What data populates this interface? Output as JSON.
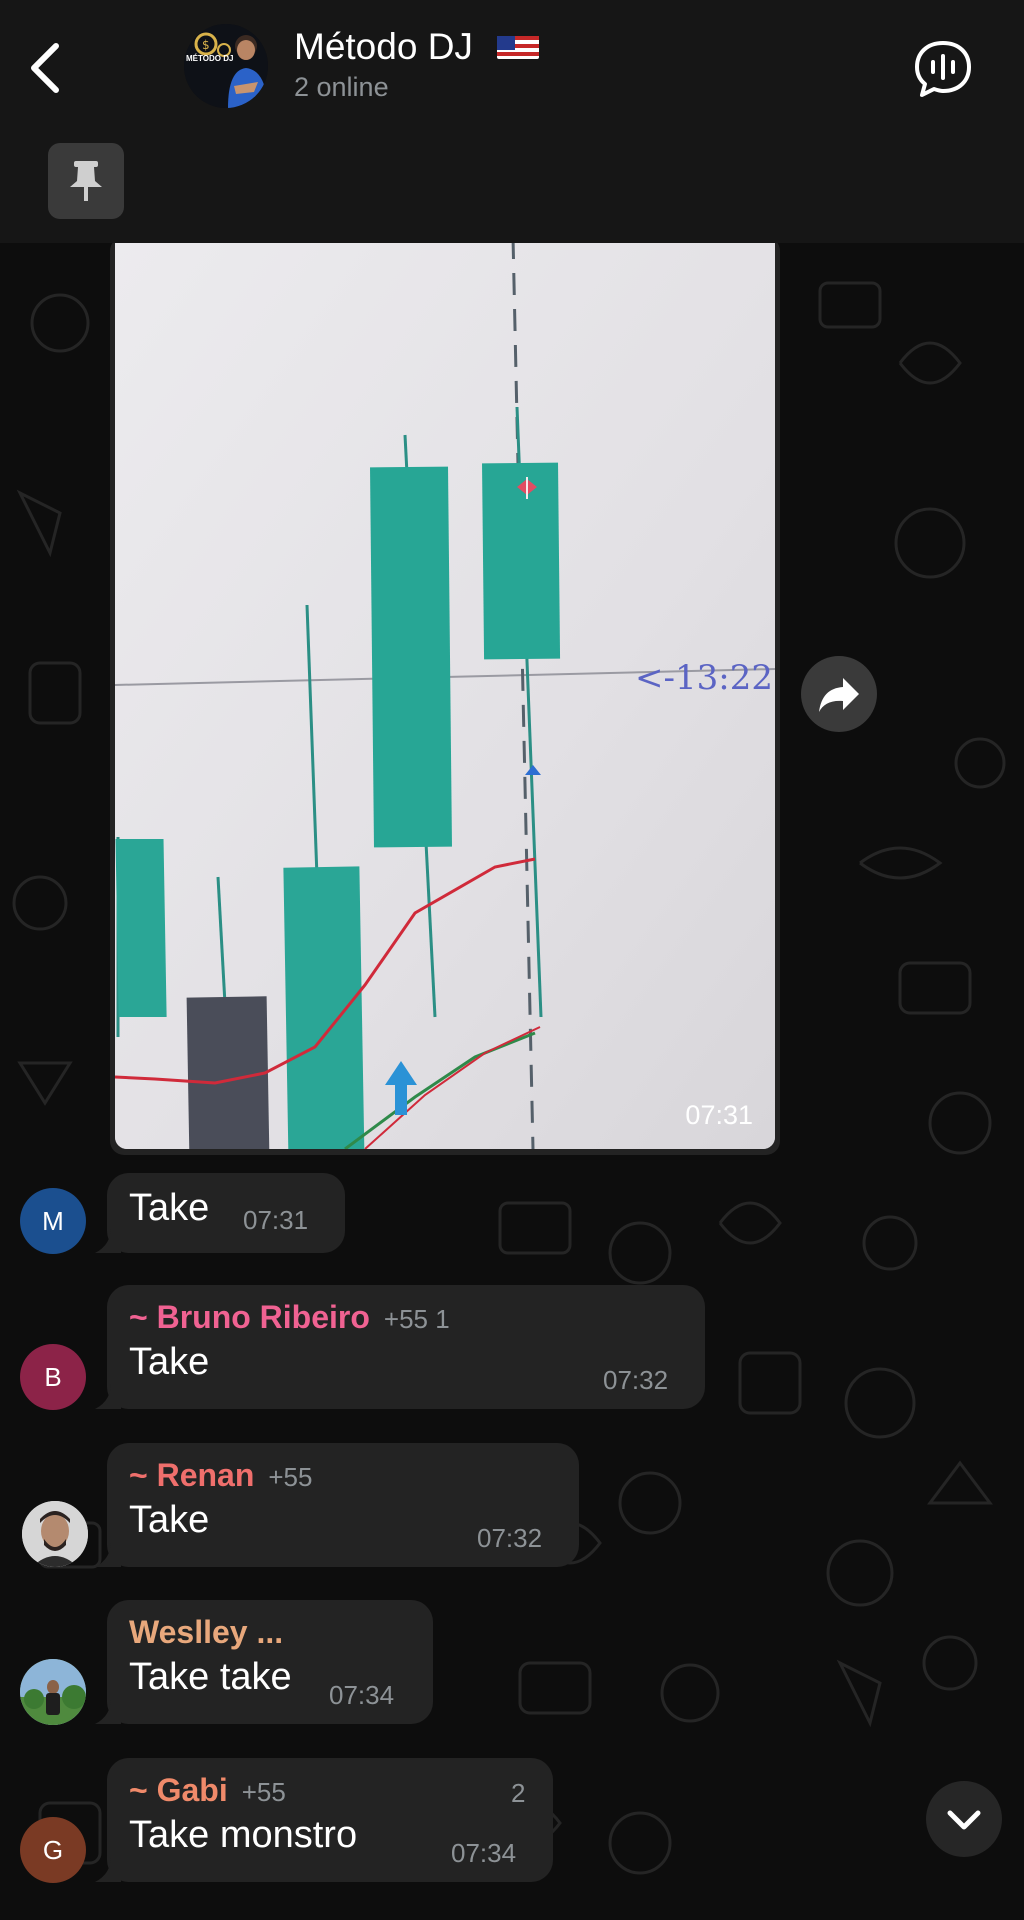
{
  "header": {
    "title": "Método DJ",
    "subtitle": "2 online",
    "group_avatar_text": "MÉTODO DJ"
  },
  "photo_message": {
    "time": "07:31",
    "overlay_text": "<-13:22"
  },
  "messages": [
    {
      "avatar_letter": "M",
      "avatar_color": "#1b4f8f",
      "sender": "",
      "phone": "",
      "text": "Take",
      "time": "07:31"
    },
    {
      "avatar_letter": "B",
      "avatar_color": "#8c2348",
      "sender": "~ Bruno Ribeiro",
      "sender_color": "#f06292",
      "phone": "+55 1",
      "text": "Take",
      "time": "07:32"
    },
    {
      "avatar_letter": "",
      "sender": "~ Renan",
      "sender_color": "#ef6f6c",
      "phone": "+55",
      "text": "Take",
      "time": "07:32"
    },
    {
      "avatar_letter": "",
      "sender": "Weslley ...",
      "sender_color": "#e8a87c",
      "phone": "",
      "text": "Take take",
      "time": "07:34"
    },
    {
      "avatar_letter": "G",
      "avatar_color": "#7a3a24",
      "sender": "~ Gabi",
      "sender_color": "#f08a6a",
      "phone": "+55",
      "extra": "2",
      "text": "Take monstro",
      "time": "07:34"
    }
  ],
  "icons": {
    "back": "chevron-left-icon",
    "voice_chat": "voice-chat-icon",
    "pin": "pin-icon",
    "forward": "forward-icon",
    "scroll_down": "chevron-down-icon"
  },
  "colors": {
    "background": "#0b0b0b",
    "bubble": "#232323",
    "header": "#161616"
  }
}
